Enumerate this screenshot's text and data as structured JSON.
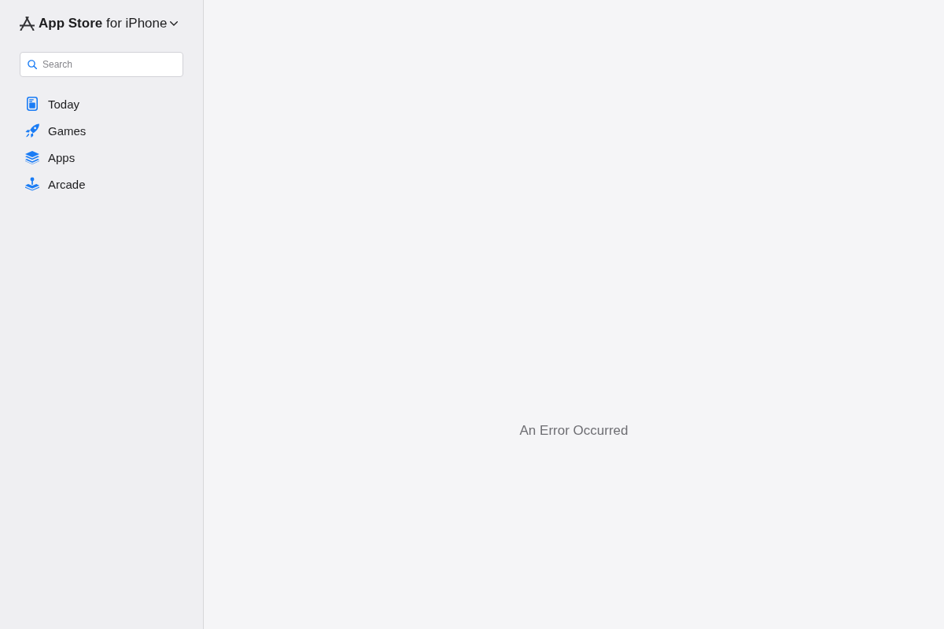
{
  "header": {
    "title": "**App Store** for iPhone"
  },
  "search": {
    "placeholder": "Search"
  },
  "sidebar": {
    "items": [
      {
        "label": "Today",
        "kind": "today"
      },
      {
        "label": "Games",
        "kind": "games"
      },
      {
        "label": "Apps",
        "kind": "apps"
      },
      {
        "label": "Arcade",
        "kind": "arcade"
      }
    ]
  },
  "main": {
    "message": "An Error Occurred"
  }
}
